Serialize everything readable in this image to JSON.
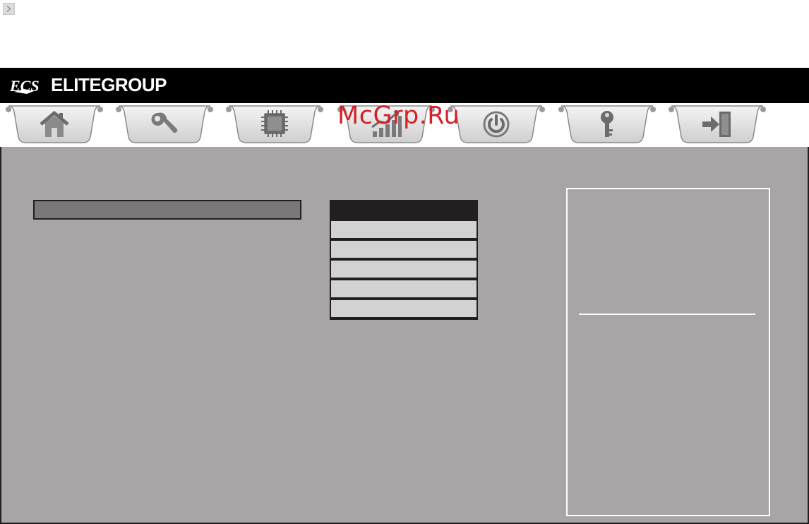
{
  "window": {
    "corner_icon": "chevron-right-icon"
  },
  "header": {
    "logo_text": "ECS",
    "brand": "ELITEGROUP",
    "background": "#000000"
  },
  "tabs": [
    {
      "id": "main",
      "icon": "home-icon",
      "active": true
    },
    {
      "id": "advanced",
      "icon": "wrench-icon"
    },
    {
      "id": "chipset",
      "icon": "chip-icon"
    },
    {
      "id": "mib",
      "icon": "performance-chart-icon"
    },
    {
      "id": "boot",
      "icon": "power-icon"
    },
    {
      "id": "security",
      "icon": "key-icon"
    },
    {
      "id": "exit",
      "icon": "exit-door-icon"
    }
  ],
  "main": {
    "background": "#a7a5a6",
    "selected_item": "",
    "options_title": "",
    "options": [
      "",
      "",
      "",
      "",
      ""
    ]
  },
  "help_panel": {
    "help_text": "",
    "key_legend": ""
  },
  "watermark": "McGrp.Ru",
  "colors": {
    "accent_red": "#d2232a",
    "frame": "#231f20",
    "tab_fill": "#e6e6e6"
  }
}
